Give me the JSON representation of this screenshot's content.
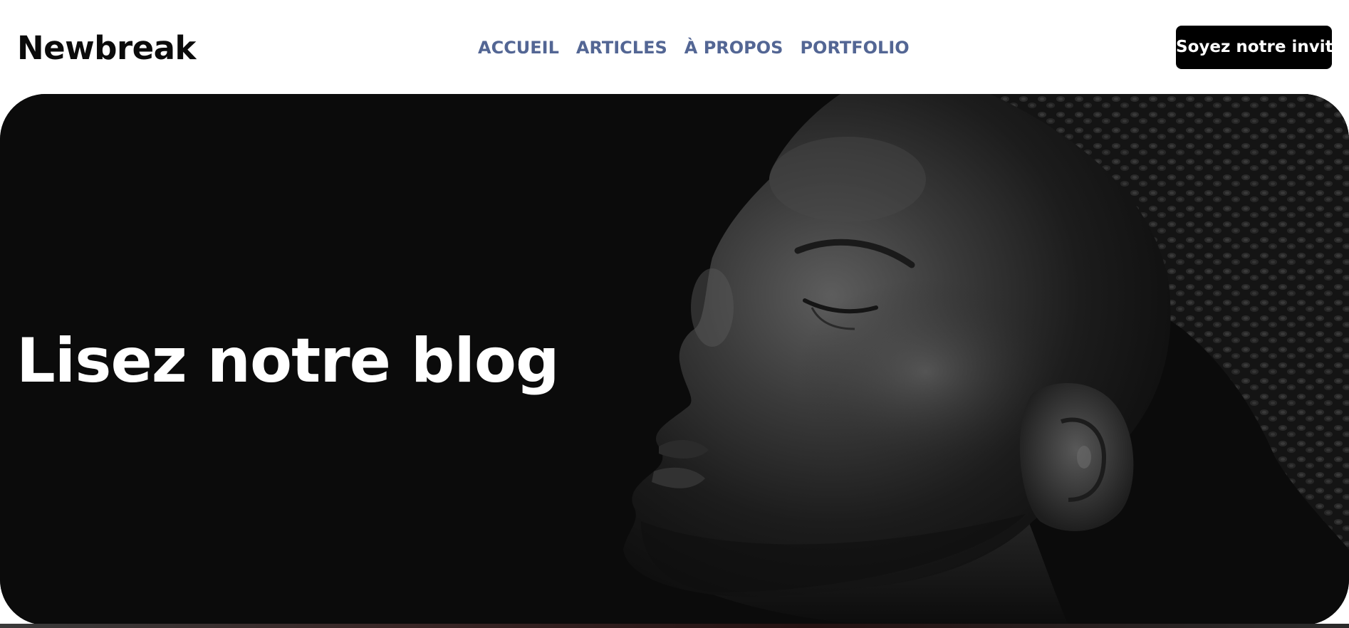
{
  "header": {
    "brand": "Newbreak",
    "nav": [
      {
        "label": "ACCUEIL"
      },
      {
        "label": "ARTICLES"
      },
      {
        "label": "À PROPOS"
      },
      {
        "label": "PORTFOLIO"
      }
    ],
    "cta_label": "Soyez notre invité"
  },
  "hero": {
    "title": "Lisez notre blog",
    "image": "portrait of a woman in profile with eyes closed, black and white"
  },
  "colors": {
    "nav_text": "#536694",
    "brand_text": "#0b0b0b",
    "cta_background": "#000000",
    "cta_text": "#ffffff",
    "hero_background": "#0b0b0b",
    "hero_title": "#ffffff"
  }
}
